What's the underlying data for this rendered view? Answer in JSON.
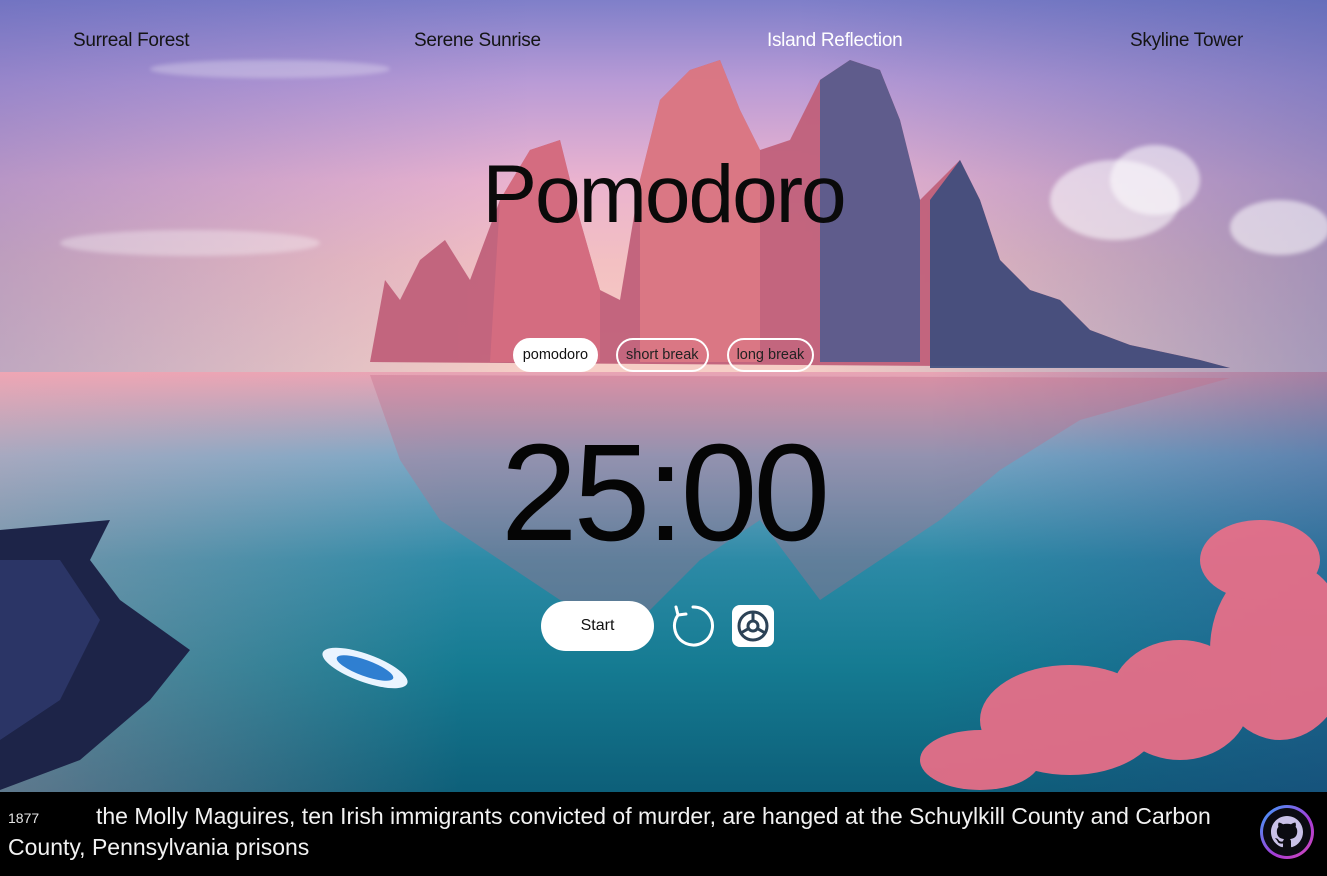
{
  "nav": {
    "items": [
      {
        "label": "Surreal Forest"
      },
      {
        "label": "Serene Sunrise"
      },
      {
        "label": "Island Reflection"
      },
      {
        "label": "Skyline Tower"
      }
    ],
    "active_index": 2
  },
  "app": {
    "title": "Pomodoro"
  },
  "modes": [
    {
      "label": "pomodoro"
    },
    {
      "label": "short break"
    },
    {
      "label": "long break"
    }
  ],
  "active_mode": "pomodoro",
  "timer": {
    "display": "25:00"
  },
  "controls": {
    "start_label": "Start",
    "reset_icon": "reset-icon",
    "settings_icon": "settings-icon"
  },
  "footer": {
    "year": "1877",
    "fact": "the Molly Maguires, ten Irish immigrants convicted of murder, are hanged at the Schuylkill County and Carbon County, Pennsylvania prisons",
    "github_icon": "github-icon"
  },
  "colors": {
    "active_nav": "#ffffff",
    "text_dark": "#0a0a0a",
    "footer_bg": "#000000",
    "github_ring_start": "#39a3ff",
    "github_ring_end": "#d54ab8"
  }
}
